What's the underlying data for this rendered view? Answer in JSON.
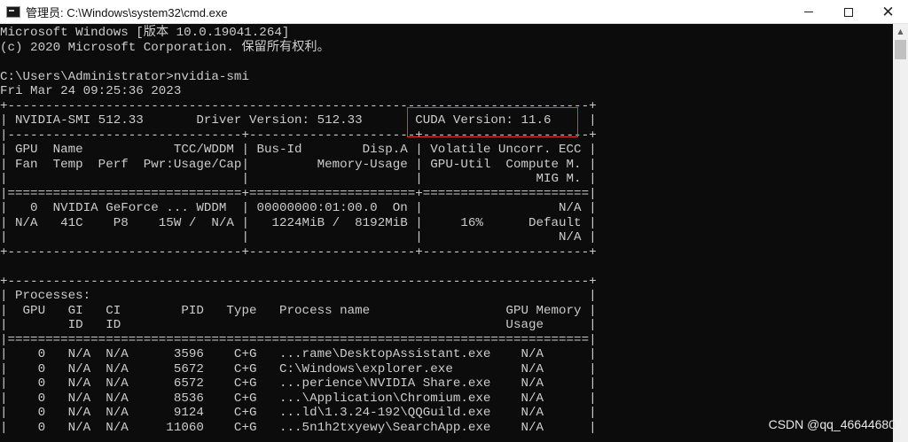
{
  "window": {
    "title": "管理员: C:\\Windows\\system32\\cmd.exe",
    "minimize_glyph": "",
    "maximize_glyph": "",
    "close_glyph": "✕"
  },
  "console": {
    "lines": [
      "Microsoft Windows [版本 10.0.19041.264]",
      "(c) 2020 Microsoft Corporation. 保留所有权利。",
      "",
      "C:\\Users\\Administrator>nvidia-smi",
      "Fri Mar 24 09:25:36 2023",
      "+-----------------------------------------------------------------------------+",
      "| NVIDIA-SMI 512.33       Driver Version: 512.33       CUDA Version: 11.6     |",
      "|-------------------------------+----------------------+----------------------+",
      "| GPU  Name            TCC/WDDM | Bus-Id        Disp.A | Volatile Uncorr. ECC |",
      "| Fan  Temp  Perf  Pwr:Usage/Cap|         Memory-Usage | GPU-Util  Compute M. |",
      "|                               |                      |               MIG M. |",
      "|===============================+======================+======================|",
      "|   0  NVIDIA GeForce ... WDDM  | 00000000:01:00.0  On |                  N/A |",
      "| N/A   41C    P8    15W /  N/A |   1224MiB /  8192MiB |     16%      Default |",
      "|                               |                      |                  N/A |",
      "+-------------------------------+----------------------+----------------------+",
      "",
      "+-----------------------------------------------------------------------------+",
      "| Processes:                                                                  |",
      "|  GPU   GI   CI        PID   Type   Process name                  GPU Memory |",
      "|        ID   ID                                                   Usage      |",
      "|=============================================================================|",
      "|    0   N/A  N/A      3596    C+G   ...rame\\DesktopAssistant.exe    N/A      |",
      "|    0   N/A  N/A      5672    C+G   C:\\Windows\\explorer.exe         N/A      |",
      "|    0   N/A  N/A      6572    C+G   ...perience\\NVIDIA Share.exe    N/A      |",
      "|    0   N/A  N/A      8536    C+G   ...\\Application\\Chromium.exe    N/A      |",
      "|    0   N/A  N/A      9124    C+G   ...ld\\1.3.24-192\\QQGuild.exe    N/A      |",
      "|    0   N/A  N/A     11060    C+G   ...5n1h2txyewy\\SearchApp.exe    N/A      |"
    ]
  },
  "watermark": "CSDN @qq_46644680",
  "colors": {
    "console_bg": "#0c0c0c",
    "console_fg": "#cccccc",
    "highlight_box": "#e0393b"
  }
}
